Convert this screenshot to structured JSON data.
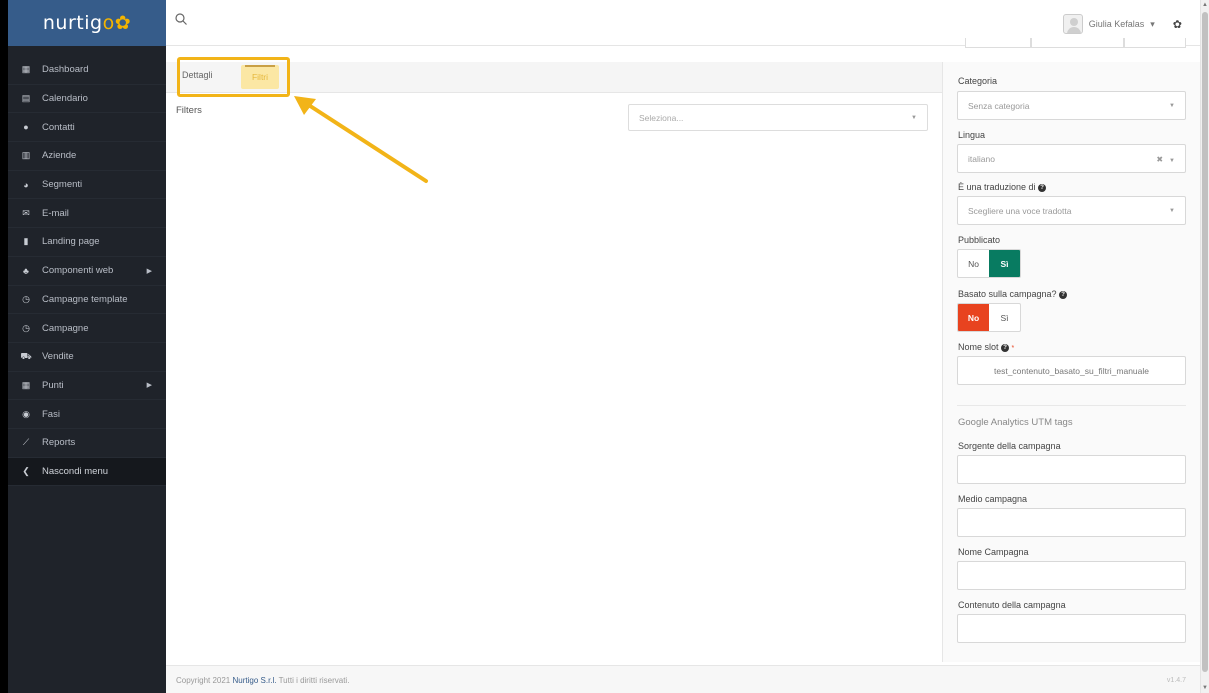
{
  "app": {
    "logo_text": "nurtig",
    "logo_accent": "o",
    "brand_color": "#365c8a",
    "accent_color": "#f4b400"
  },
  "sidebar": {
    "items": [
      {
        "label": "Dashboard",
        "icon": "grid-icon"
      },
      {
        "label": "Calendario",
        "icon": "calendar-icon"
      },
      {
        "label": "Contatti",
        "icon": "user-icon"
      },
      {
        "label": "Aziende",
        "icon": "building-icon"
      },
      {
        "label": "Segmenti",
        "icon": "pie-chart-icon"
      },
      {
        "label": "E-mail",
        "icon": "envelope-icon"
      },
      {
        "label": "Landing page",
        "icon": "file-icon"
      },
      {
        "label": "Componenti web",
        "icon": "puzzle-icon",
        "has_submenu": true
      },
      {
        "label": "Campagne template",
        "icon": "clock-icon"
      },
      {
        "label": "Campagne",
        "icon": "clock-icon"
      },
      {
        "label": "Vendite",
        "icon": "cart-icon"
      },
      {
        "label": "Punti",
        "icon": "calculator-icon",
        "has_submenu": true
      },
      {
        "label": "Fasi",
        "icon": "tachometer-icon"
      },
      {
        "label": "Reports",
        "icon": "line-chart-icon"
      },
      {
        "label": "Nascondi menu",
        "icon": "chevron-left-icon"
      }
    ]
  },
  "topbar": {
    "user_name": "Giulia Kefalas",
    "user_caret": "▾"
  },
  "tabs": {
    "dettagli": "Dettagli",
    "filtri": "Filtri"
  },
  "filters": {
    "label": "Filters",
    "select_placeholder": "Seleziona..."
  },
  "form": {
    "categoria_label": "Categoria",
    "categoria_value": "Senza categoria",
    "lingua_label": "Lingua",
    "lingua_value": "italiano",
    "traduzione_label": "È una traduzione di",
    "traduzione_value": "Scegliere una voce tradotta",
    "pubblicato_label": "Pubblicato",
    "pubblicato_no": "No",
    "pubblicato_si": "Sì",
    "campagna_label": "Basato sulla campagna?",
    "campagna_no": "No",
    "campagna_si": "Sì",
    "slot_label": "Nome slot",
    "slot_value": "test_contenuto_basato_su_filtri_manuale",
    "utm_title": "Google Analytics UTM tags",
    "sorgente_label": "Sorgente della campagna",
    "medio_label": "Medio campagna",
    "nome_campagna_label": "Nome Campagna",
    "contenuto_label": "Contenuto della campagna"
  },
  "footer": {
    "copyright_prefix": "Copyright 2021",
    "brand": "Nurtigo S.r.l.",
    "copyright_suffix": "Tutti i diritti riservati.",
    "version": "v1.4.7"
  }
}
